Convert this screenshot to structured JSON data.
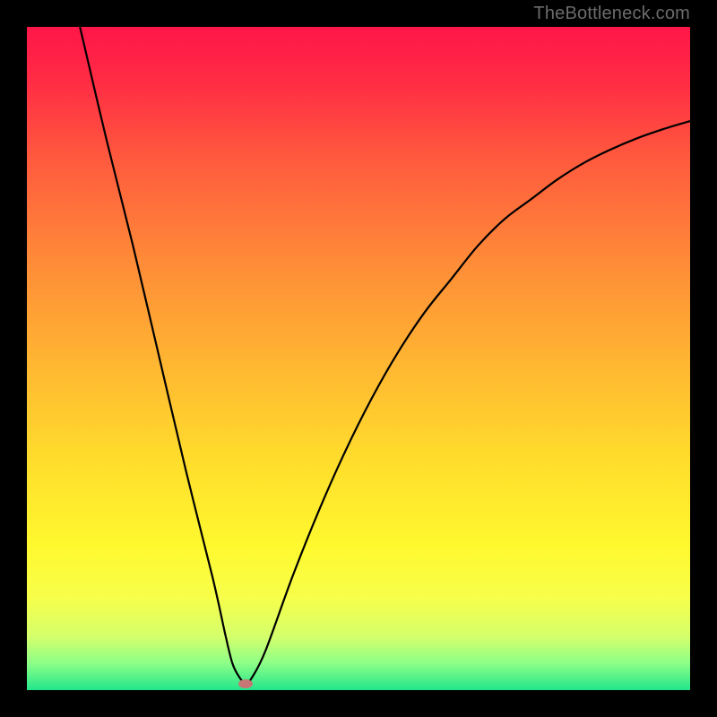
{
  "watermark": "TheBottleneck.com",
  "chart_data": {
    "type": "line",
    "title": "",
    "xlabel": "",
    "ylabel": "",
    "xlim": [
      0,
      100
    ],
    "ylim": [
      0,
      100
    ],
    "x": [
      8,
      12,
      16,
      20,
      24,
      28,
      30,
      31,
      32,
      33,
      34,
      36,
      40,
      44,
      48,
      52,
      56,
      60,
      64,
      68,
      72,
      76,
      80,
      84,
      88,
      92,
      96,
      100
    ],
    "y": [
      100,
      83,
      67,
      50,
      33,
      17,
      8,
      4,
      2,
      1,
      2,
      6,
      17,
      27,
      36,
      44,
      51,
      57,
      62,
      67,
      71,
      74,
      77,
      79.5,
      81.5,
      83.2,
      84.6,
      85.8
    ],
    "optimum_x": 33,
    "marker_color": "#c77676",
    "gradient_stops": [
      {
        "pos": 0.0,
        "color": "#ff1649"
      },
      {
        "pos": 0.08,
        "color": "#ff2b44"
      },
      {
        "pos": 0.2,
        "color": "#ff5a3e"
      },
      {
        "pos": 0.35,
        "color": "#ff8a38"
      },
      {
        "pos": 0.5,
        "color": "#ffb432"
      },
      {
        "pos": 0.65,
        "color": "#ffdc2c"
      },
      {
        "pos": 0.78,
        "color": "#fff82e"
      },
      {
        "pos": 0.86,
        "color": "#f7ff4a"
      },
      {
        "pos": 0.92,
        "color": "#d4ff6c"
      },
      {
        "pos": 0.96,
        "color": "#8cff88"
      },
      {
        "pos": 1.0,
        "color": "#22e58a"
      }
    ]
  }
}
